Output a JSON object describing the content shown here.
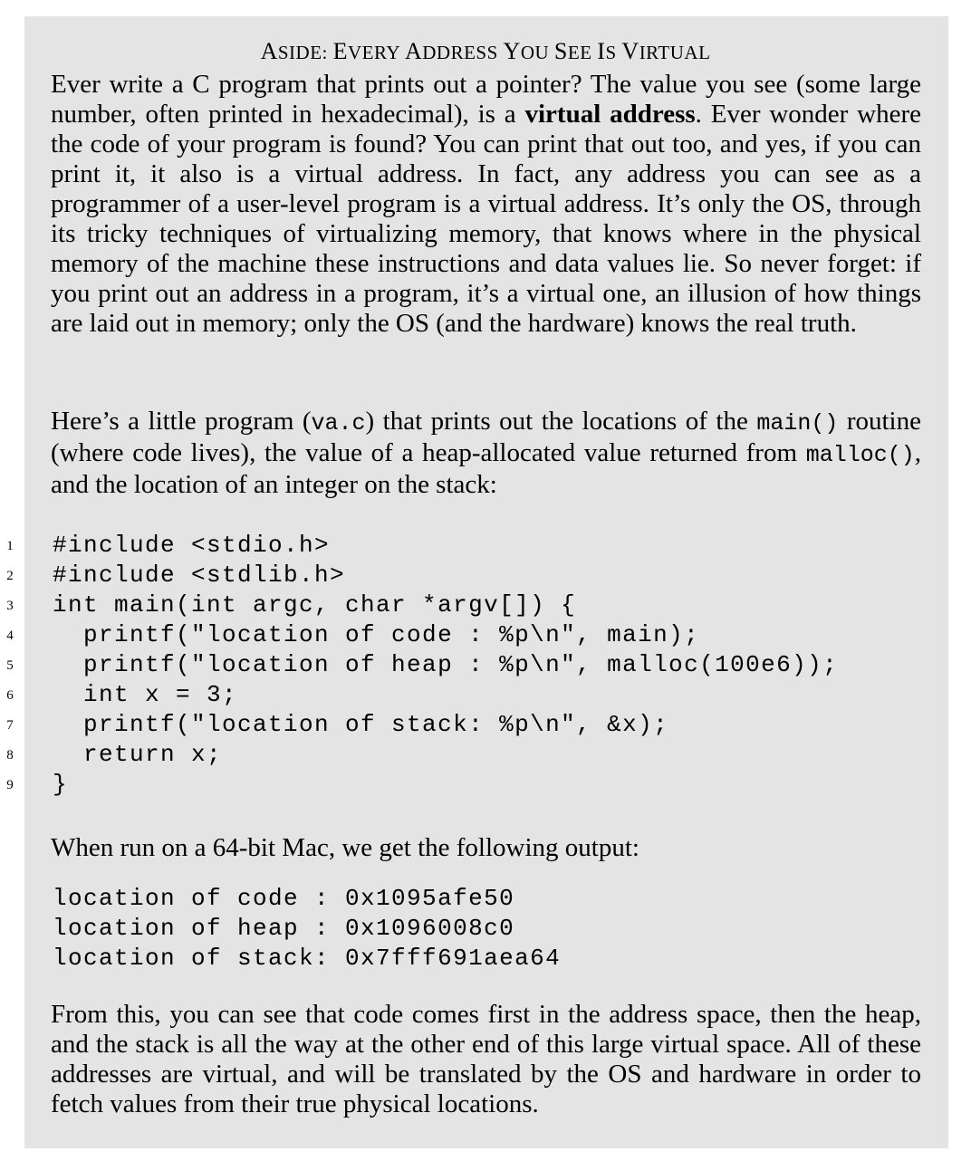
{
  "aside": {
    "title_parts": [
      {
        "big": "A",
        "small": "SIDE: "
      },
      {
        "big": "E",
        "small": "VERY "
      },
      {
        "big": "A",
        "small": "DDRESS "
      },
      {
        "big": "Y",
        "small": "OU "
      },
      {
        "big": "S",
        "small": "EE "
      },
      {
        "big": "I",
        "small": "S "
      },
      {
        "big": "V",
        "small": "IRTUAL"
      }
    ],
    "intro": {
      "text_before_bold": "Ever write a C program that prints out a pointer?  The value you see (some large number, often printed in hexadecimal), is a ",
      "bold": "virtual address",
      "text_after_bold": ". Ever wonder where the code of your program is found? You can print that out too, and yes, if you can print it, it also is a virtual address. In fact, any address you can see as a programmer of a user-level program is a virtual address.  It’s only the OS, through its tricky techniques of virtualizing memory, that knows where in the physical memory of the machine these instructions and data values lie. So never forget: if you print out an address in a program, it’s a virtual one, an illusion of how things are laid out in memory; only the OS (and the hardware) knows the real truth."
    },
    "program_intro": {
      "t1": "Here’s a little program (",
      "file": "va.c",
      "t2": ") that prints out the locations of the ",
      "main_fn": "main()",
      "t3": " routine (where code lives), the value of a heap-allocated value returned from ",
      "malloc_fn": "malloc()",
      "t4": ", and the location of an integer on the stack:"
    },
    "code": [
      {
        "num": "1",
        "text": "#include <stdio.h>"
      },
      {
        "num": "2",
        "text": "#include <stdlib.h>"
      },
      {
        "num": "3",
        "text": "int main(int argc, char *argv[]) {"
      },
      {
        "num": "4",
        "text": "  printf(\"location of code : %p\\n\", main);"
      },
      {
        "num": "5",
        "text": "  printf(\"location of heap : %p\\n\", malloc(100e6));"
      },
      {
        "num": "6",
        "text": "  int x = 3;"
      },
      {
        "num": "7",
        "text": "  printf(\"location of stack: %p\\n\", &x);"
      },
      {
        "num": "8",
        "text": "  return x;"
      },
      {
        "num": "9",
        "text": "}"
      }
    ],
    "run_text": "When run on a 64-bit Mac, we get the following output:",
    "output": [
      "location of code : 0x1095afe50",
      "location of heap : 0x1096008c0",
      "location of stack: 0x7fff691aea64"
    ],
    "conclusion": "From this, you can see that code comes first in the address space, then the heap, and the stack is all the way at the other end of this large virtual space. All of these addresses are virtual, and will be translated by the OS and hardware in order to fetch values from their true physical locations."
  }
}
